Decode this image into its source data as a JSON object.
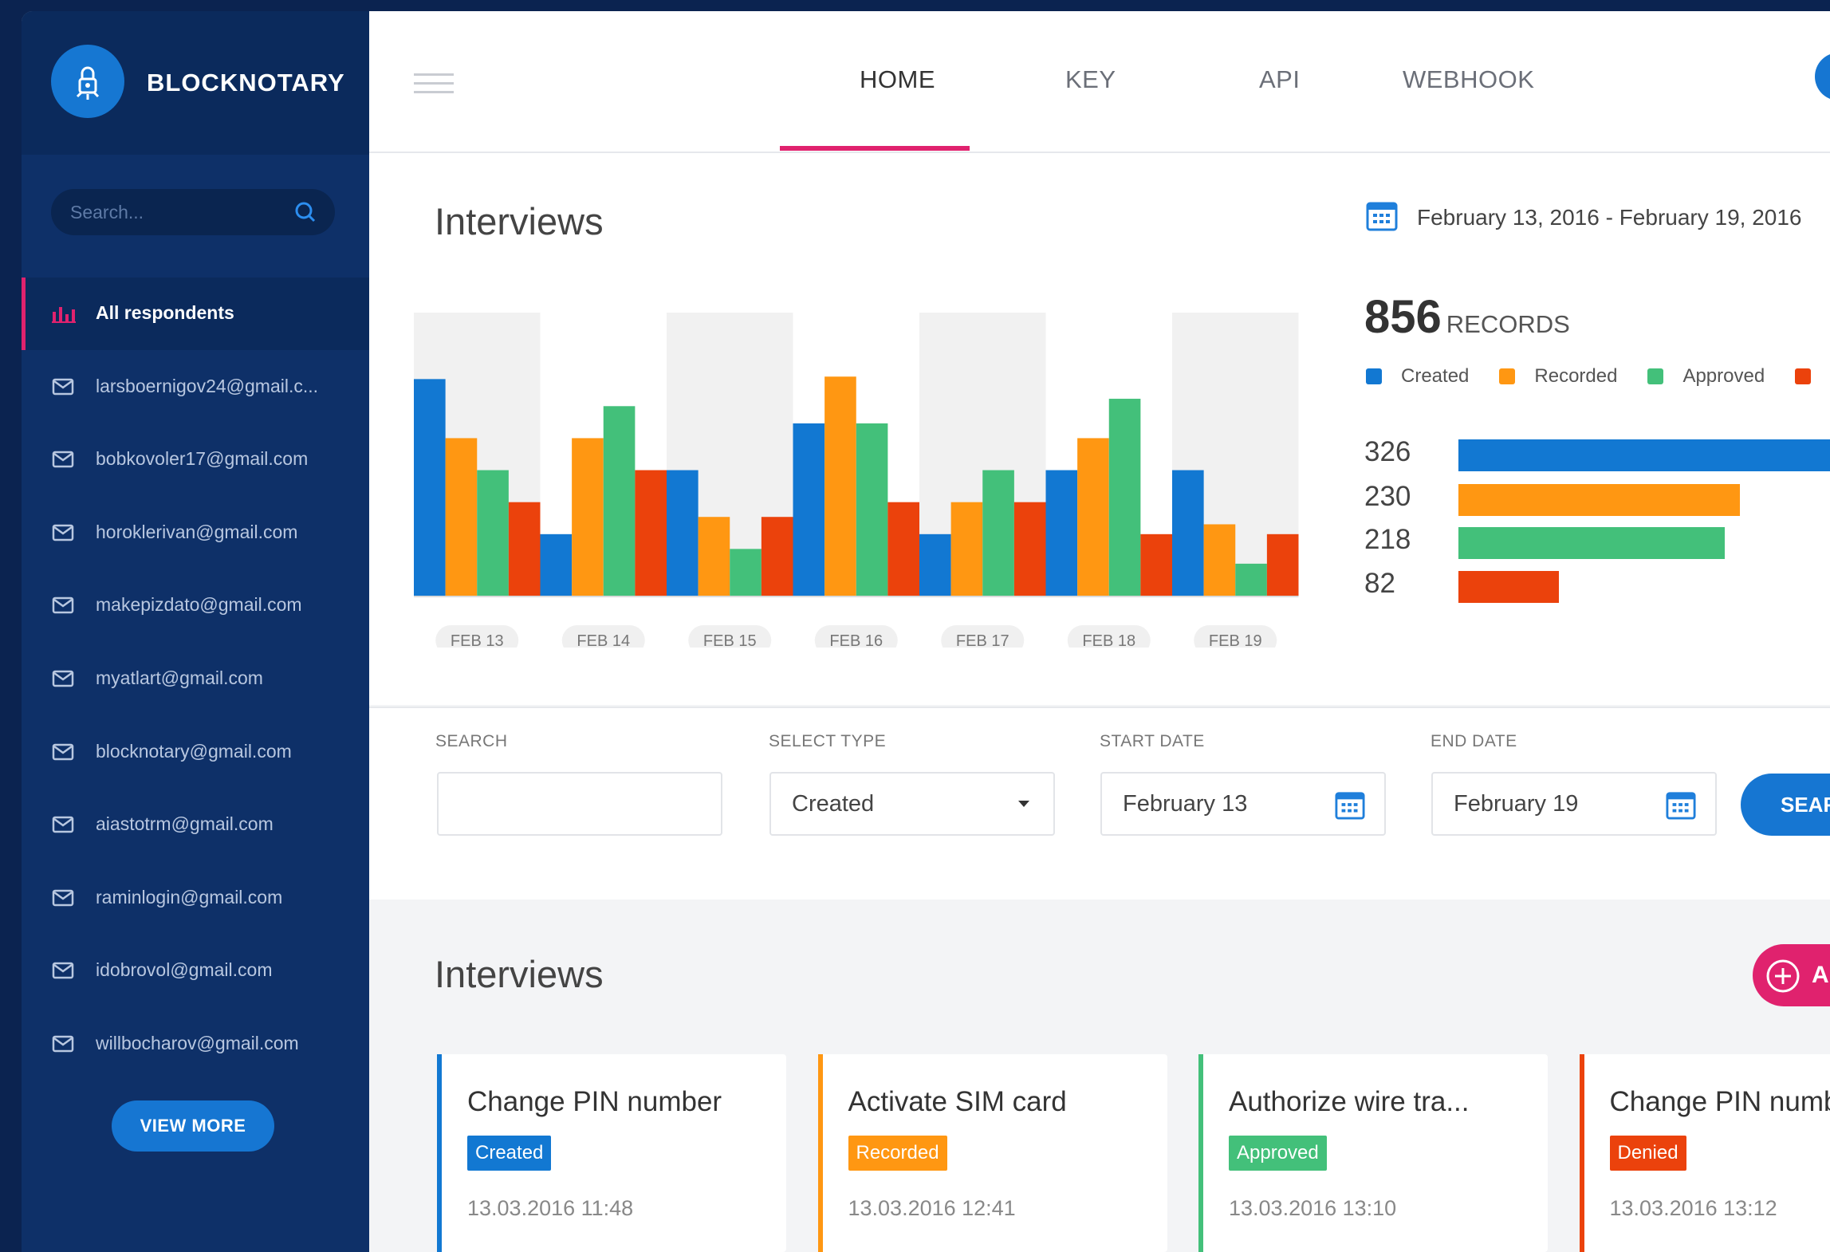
{
  "brand": {
    "name": "BLOCKNOTARY"
  },
  "sidebar": {
    "search_placeholder": "Search...",
    "items": [
      {
        "label": "All respondents",
        "icon": "bar-chart-icon",
        "active": true
      },
      {
        "label": "larsboernigov24@gmail.c...",
        "icon": "mail-icon"
      },
      {
        "label": "bobkovoler17@gmail.com",
        "icon": "mail-icon"
      },
      {
        "label": "horoklerivan@gmail.com",
        "icon": "mail-icon"
      },
      {
        "label": "makepizdato@gmail.com",
        "icon": "mail-icon"
      },
      {
        "label": "myatlart@gmail.com",
        "icon": "mail-icon"
      },
      {
        "label": "blocknotary@gmail.com",
        "icon": "mail-icon"
      },
      {
        "label": "aiastotrm@gmail.com",
        "icon": "mail-icon"
      },
      {
        "label": "raminlogin@gmail.com",
        "icon": "mail-icon"
      },
      {
        "label": "idobrovol@gmail.com",
        "icon": "mail-icon"
      },
      {
        "label": "willbocharov@gmail.com",
        "icon": "mail-icon"
      }
    ],
    "view_more": "VIEW MORE"
  },
  "nav": {
    "tabs": [
      "HOME",
      "KEY",
      "API",
      "WEBHOOK"
    ],
    "active": "HOME"
  },
  "stats": {
    "title": "Interviews",
    "date_range": "February 13, 2016 - February 19, 2016",
    "records_count": "856",
    "records_label": "RECORDS"
  },
  "colors": {
    "created": "#1278d2",
    "recorded": "#ff9712",
    "approved": "#43c07a",
    "denied": "#eb420c",
    "accent": "#e0226e"
  },
  "chart_data": {
    "type": "bar",
    "categories": [
      "FEB 13",
      "FEB 14",
      "FEB 15",
      "FEB 16",
      "FEB 17",
      "FEB 18",
      "FEB 19"
    ],
    "series": [
      {
        "name": "Created",
        "values": [
          88,
          25,
          51,
          70,
          25,
          51,
          51
        ]
      },
      {
        "name": "Recorded",
        "values": [
          64,
          64,
          32,
          89,
          38,
          64,
          29
        ]
      },
      {
        "name": "Approved",
        "values": [
          51,
          77,
          19,
          70,
          51,
          80,
          13
        ]
      },
      {
        "name": "Denied",
        "values": [
          38,
          51,
          32,
          38,
          38,
          25,
          25
        ]
      }
    ],
    "ylim": [
      0,
      115
    ]
  },
  "totals_chart": {
    "type": "bar",
    "orientation": "horizontal",
    "items": [
      {
        "name": "Created",
        "value": 326
      },
      {
        "name": "Recorded",
        "value": 230
      },
      {
        "name": "Approved",
        "value": 218
      },
      {
        "name": "Denied",
        "value": 82
      }
    ]
  },
  "filters": {
    "search_label": "SEARCH",
    "search_value": "",
    "type_label": "SELECT TYPE",
    "type_value": "Created",
    "start_label": "START DATE",
    "start_value": "February 13",
    "end_label": "END DATE",
    "end_value": "February 19",
    "search_button": "SEAR"
  },
  "list": {
    "title": "Interviews",
    "add_label": "A",
    "cards": [
      {
        "title": "Change PIN number",
        "status": "Created",
        "time": "13.03.2016 11:48",
        "color": "#1278d2"
      },
      {
        "title": "Activate SIM card",
        "status": "Recorded",
        "time": "13.03.2016 12:41",
        "color": "#ff9712"
      },
      {
        "title": "Authorize wire tra...",
        "status": "Approved",
        "time": "13.03.2016 13:10",
        "color": "#43c07a"
      },
      {
        "title": "Change PIN numb",
        "status": "Denied",
        "time": "13.03.2016 13:12",
        "color": "#eb420c"
      }
    ]
  }
}
